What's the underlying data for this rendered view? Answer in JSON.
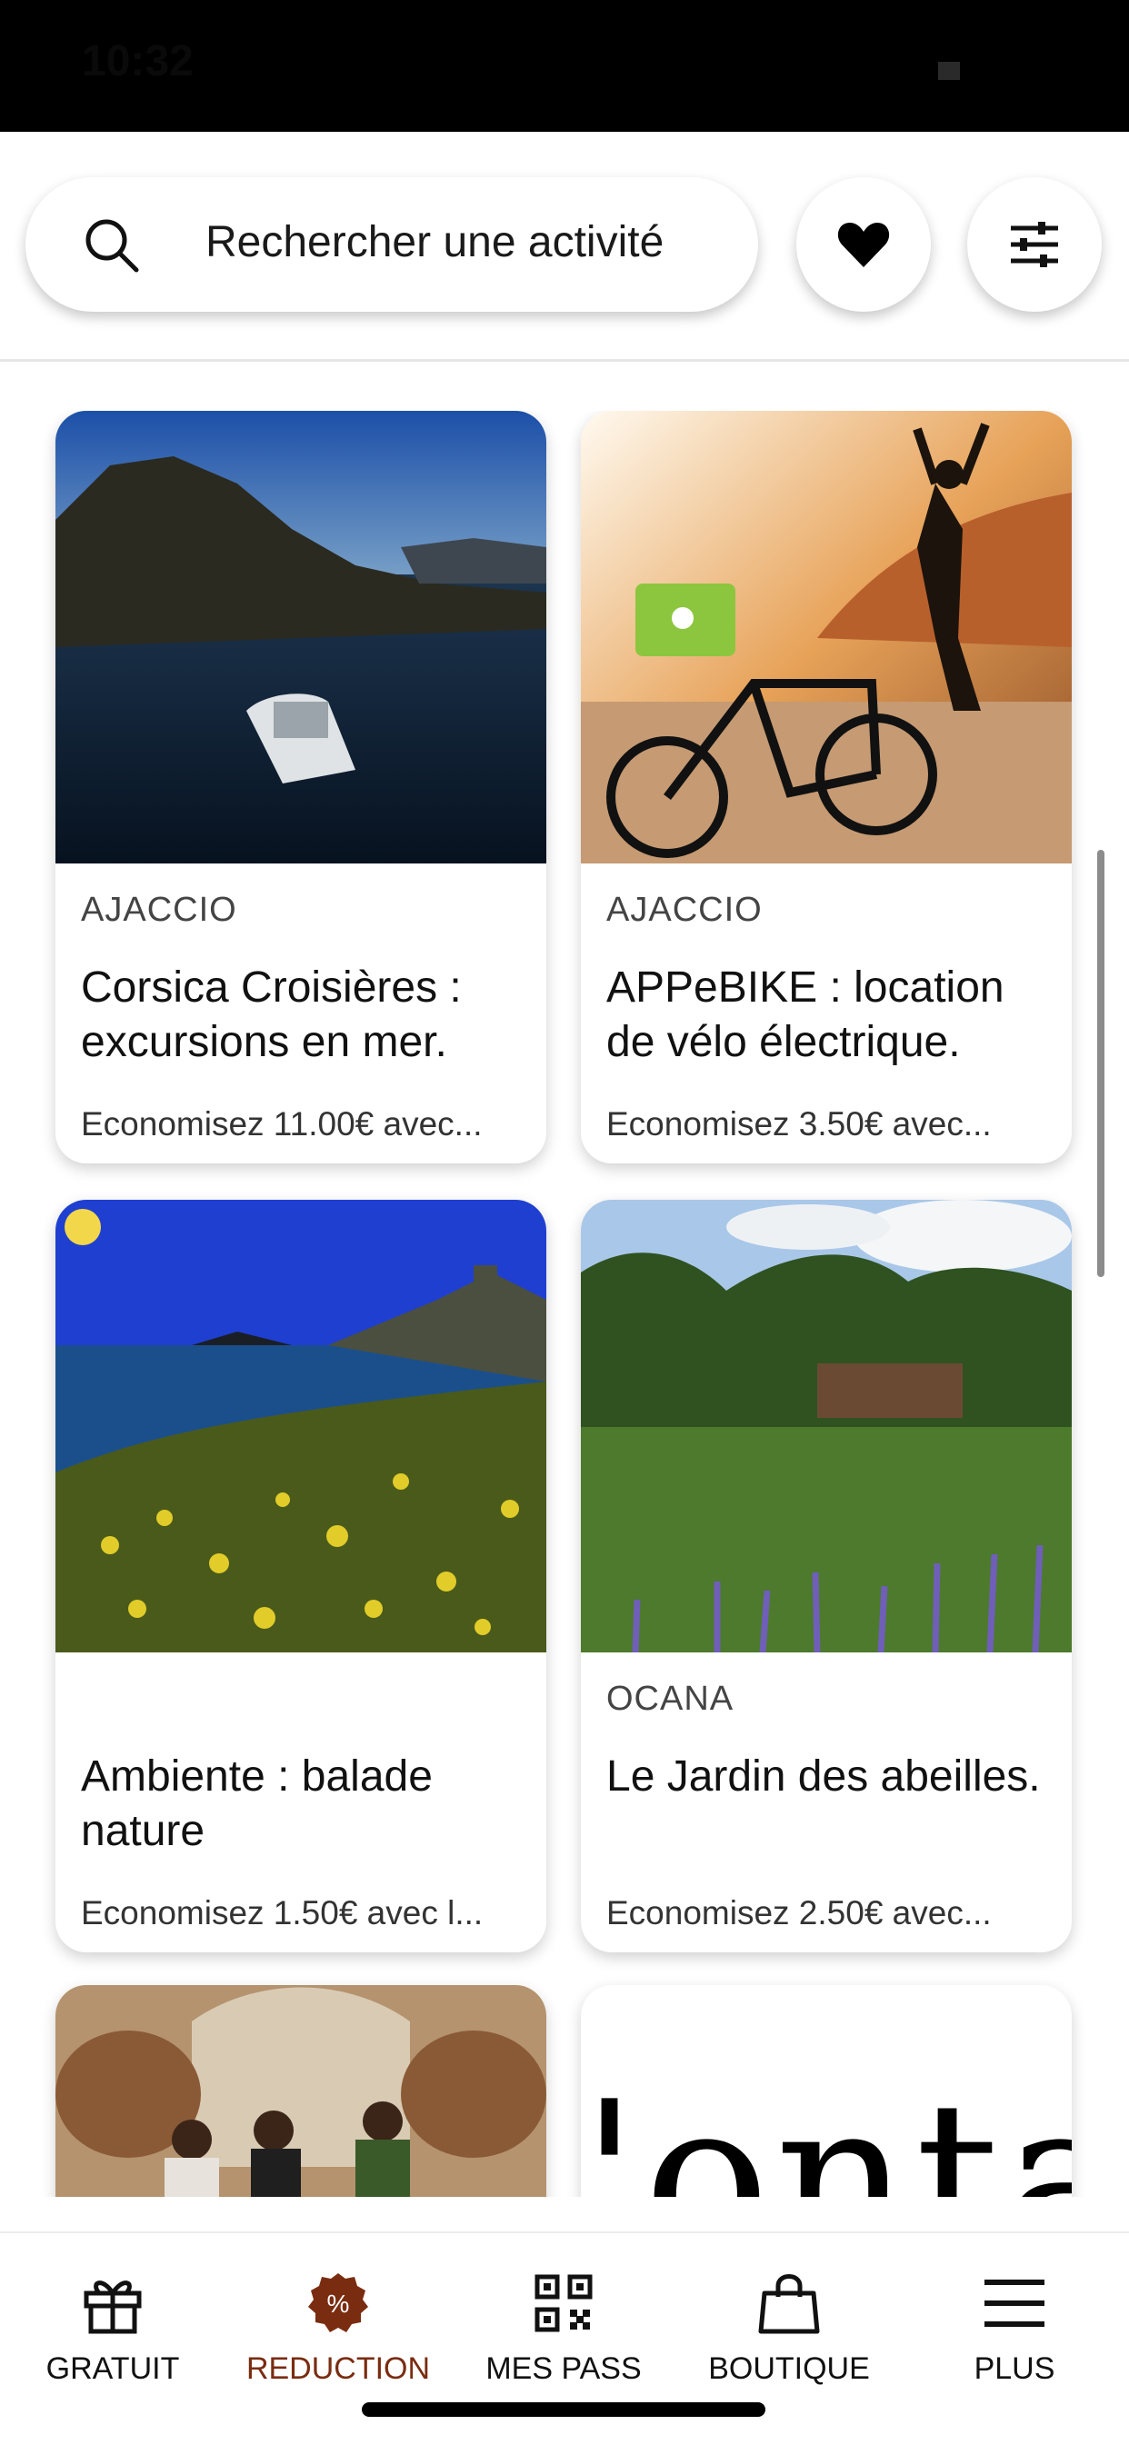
{
  "status_bar": {
    "time": "10:32"
  },
  "search": {
    "placeholder": "Rechercher une activité"
  },
  "cards": [
    {
      "city": "AJACCIO",
      "title": "Corsica Croisières : excursions en mer.",
      "saving": "Economisez 11.00€ avec..."
    },
    {
      "city": "AJACCIO",
      "title": "APPeBIKE : location de  vélo électrique.",
      "saving": "Economisez 3.50€ avec..."
    },
    {
      "city": "",
      "title": "Ambiente :  balade nature",
      "saving": "Economisez 1.50€ avec l..."
    },
    {
      "city": "OCANA",
      "title": "Le Jardin des abeilles.",
      "saving": "Economisez 2.50€ avec..."
    },
    {
      "city": "",
      "title": "",
      "saving": ""
    },
    {
      "city": "",
      "title": "",
      "saving": "",
      "image_text": "'ontar"
    }
  ],
  "tab_bar": {
    "items": [
      {
        "label": "GRATUIT",
        "icon": "gift-icon"
      },
      {
        "label": "REDUCTION",
        "icon": "percent-badge-icon"
      },
      {
        "label": "MES PASS",
        "icon": "qr-code-icon"
      },
      {
        "label": "BOUTIQUE",
        "icon": "shopping-bag-icon"
      },
      {
        "label": "PLUS",
        "icon": "menu-icon"
      }
    ],
    "active_index": 1
  },
  "colors": {
    "accent": "#7a2c10",
    "text": "#111111",
    "card_bg": "#ffffff"
  }
}
